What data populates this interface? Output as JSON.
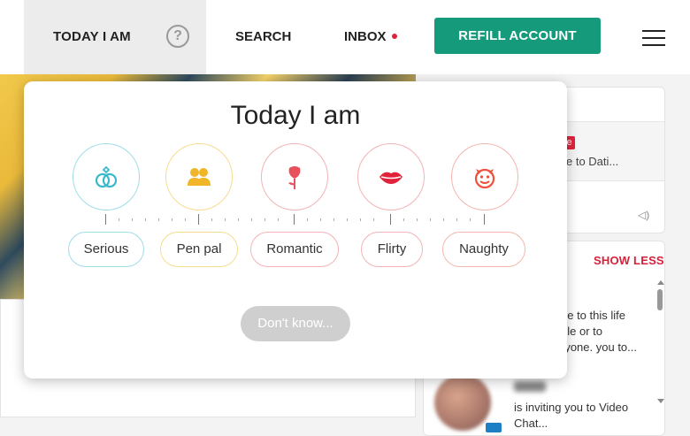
{
  "nav": {
    "today_label": "TODAY I AM",
    "help_symbol": "?",
    "search_label": "SEARCH",
    "inbox_label": "INBOX",
    "refill_label": "REFILL ACCOUNT"
  },
  "sidebar_top": {
    "badge": "e",
    "snippet": "e to Dati..."
  },
  "chat_panel": {
    "show_less_label": "SHOW LESS",
    "message_lines": [
      "ne to this life",
      "ble or to",
      "ryone. you to..."
    ],
    "invite_line1": "is inviting you to Video",
    "invite_line2": "Chat..."
  },
  "modal": {
    "title": "Today I am",
    "moods": [
      {
        "label": "Serious",
        "icon": "rings-icon",
        "color": "#5ac8d8"
      },
      {
        "label": "Pen pal",
        "icon": "people-icon",
        "color": "#f0b528"
      },
      {
        "label": "Romantic",
        "icon": "rose-icon",
        "color": "#e8505b"
      },
      {
        "label": "Flirty",
        "icon": "lips-icon",
        "color": "#e0233b"
      },
      {
        "label": "Naughty",
        "icon": "devil-icon",
        "color": "#f04f3a"
      }
    ],
    "dont_know_label": "Don't know..."
  },
  "colors": {
    "accent_green": "#159a7c",
    "accent_red": "#d6213a",
    "disabled_grey": "#cfcfcf"
  }
}
